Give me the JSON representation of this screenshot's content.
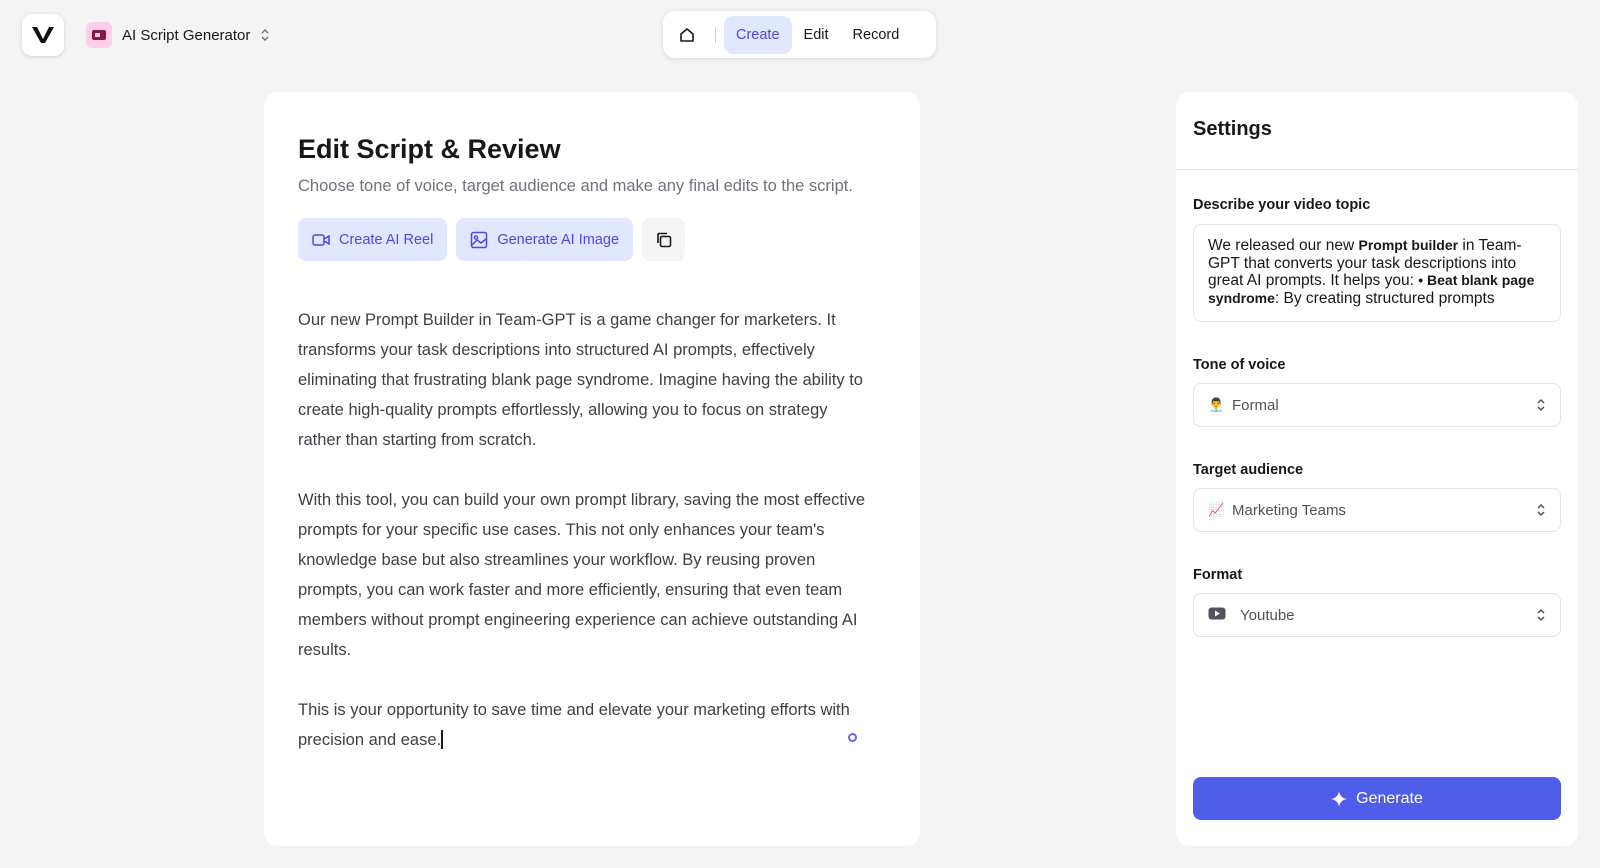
{
  "app": {
    "title": "AI Script Generator"
  },
  "nav": {
    "tabs": [
      {
        "label": "Create",
        "active": true
      },
      {
        "label": "Edit",
        "active": false
      },
      {
        "label": "Record",
        "active": false
      }
    ]
  },
  "editor": {
    "title": "Edit Script & Review",
    "subtitle": "Choose tone of voice, target audience and make any final edits to the script.",
    "actions": {
      "create_reel": "Create AI Reel",
      "generate_image": "Generate AI Image"
    },
    "paragraphs": [
      "Our new Prompt Builder in Team-GPT is a game changer for marketers. It transforms your task descriptions into structured AI prompts, effectively eliminating that frustrating blank page syndrome. Imagine having the ability to create high-quality prompts effortlessly, allowing you to focus on strategy rather than starting from scratch.",
      "With this tool, you can build your own prompt library, saving the most effective prompts for your specific use cases. This not only enhances your team's knowledge base but also streamlines your workflow. By reusing proven prompts, you can work faster and more efficiently, ensuring that even team members without prompt engineering experience can achieve outstanding AI results.",
      "This is your opportunity to save time and elevate your marketing efforts with precision and ease."
    ]
  },
  "settings": {
    "title": "Settings",
    "topic": {
      "label": "Describe your video topic",
      "text_1": "We released our new ",
      "bold_1": "Prompt builder",
      "text_2": " in Team-GPT that converts your task descriptions into great AI prompts.   It helps you: ",
      "bold_2": "• Beat blank page syndrome",
      "text_3": ": By creating structured prompts"
    },
    "tone": {
      "label": "Tone of voice",
      "emoji": "👨‍💼",
      "value": "Formal"
    },
    "audience": {
      "label": "Target audience",
      "emoji": "📈",
      "value": "Marketing Teams"
    },
    "format": {
      "label": "Format",
      "value": "Youtube"
    },
    "generate_label": "Generate"
  },
  "colors": {
    "accent": "#4f46e5",
    "accent_bg": "#e0e7ff",
    "button": "#4f5ee8"
  }
}
